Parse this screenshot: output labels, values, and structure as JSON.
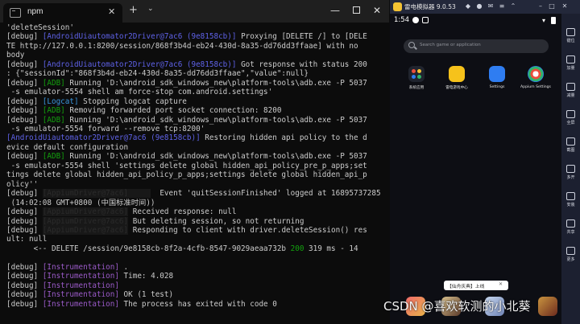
{
  "terminal": {
    "tab_title": "npm",
    "tab_close": "✕",
    "new_tab": "+",
    "dropdown": "⌄",
    "minimize": "—",
    "close": "✕",
    "lines": [
      {
        "segments": [
          {
            "t": "'deleteSession'",
            "c": ""
          }
        ]
      },
      {
        "segments": [
          {
            "t": "[debug] ",
            "c": ""
          },
          {
            "t": "[AndroidUiautomator2Driver@7ac6 (9e8158cb)]",
            "c": "blue"
          },
          {
            "t": " Proxying [DELETE /] to [DELE",
            "c": ""
          }
        ]
      },
      {
        "segments": [
          {
            "t": "TE http://127.0.0.1:8200/session/868f3b4d-eb24-430d-8a35-dd76dd3ffaae] with no",
            "c": ""
          }
        ]
      },
      {
        "segments": [
          {
            "t": "body",
            "c": ""
          }
        ]
      },
      {
        "segments": [
          {
            "t": "[debug] ",
            "c": ""
          },
          {
            "t": "[AndroidUiautomator2Driver@7ac6 (9e8158cb)]",
            "c": "blue"
          },
          {
            "t": " Got response with status 200",
            "c": ""
          }
        ]
      },
      {
        "segments": [
          {
            "t": ": {\"sessionId\":\"868f3b4d-eb24-430d-8a35-dd76dd3ffaae\",\"value\":null}",
            "c": ""
          }
        ]
      },
      {
        "segments": [
          {
            "t": "[debug] ",
            "c": ""
          },
          {
            "t": "[ADB]",
            "c": "green"
          },
          {
            "t": " Running 'D:\\android_sdk_windows_new\\platform-tools\\adb.exe -P 5037",
            "c": ""
          }
        ]
      },
      {
        "segments": [
          {
            "t": " -s emulator-5554 shell am force-stop com.android.settings'",
            "c": ""
          }
        ]
      },
      {
        "segments": [
          {
            "t": "[debug] ",
            "c": ""
          },
          {
            "t": "[Logcat]",
            "c": "lblue"
          },
          {
            "t": " Stopping logcat capture",
            "c": ""
          }
        ]
      },
      {
        "segments": [
          {
            "t": "[debug] ",
            "c": ""
          },
          {
            "t": "[ADB]",
            "c": "green"
          },
          {
            "t": " Removing forwarded port socket connection: 8200",
            "c": ""
          }
        ]
      },
      {
        "segments": [
          {
            "t": "[debug] ",
            "c": ""
          },
          {
            "t": "[ADB]",
            "c": "green"
          },
          {
            "t": " Running 'D:\\android_sdk_windows_new\\platform-tools\\adb.exe -P 5037",
            "c": ""
          }
        ]
      },
      {
        "segments": [
          {
            "t": " -s emulator-5554 forward --remove tcp:8200'",
            "c": ""
          }
        ]
      },
      {
        "segments": [
          {
            "t": "[AndroidUiautomator2Driver@7ac6 (9e8158cb)]",
            "c": "blue"
          },
          {
            "t": " Restoring hidden api policy to the d",
            "c": ""
          }
        ]
      },
      {
        "segments": [
          {
            "t": "evice default configuration",
            "c": ""
          }
        ]
      },
      {
        "segments": [
          {
            "t": "[debug] ",
            "c": ""
          },
          {
            "t": "[ADB]",
            "c": "green"
          },
          {
            "t": " Running 'D:\\android_sdk_windows_new\\platform-tools\\adb.exe -P 5037",
            "c": ""
          }
        ]
      },
      {
        "segments": [
          {
            "t": " -s emulator-5554 shell 'settings delete global hidden_api_policy_pre_p_apps;set",
            "c": ""
          }
        ]
      },
      {
        "segments": [
          {
            "t": "tings delete global hidden_api_policy_p_apps;settings delete global hidden_api_p",
            "c": ""
          }
        ]
      },
      {
        "segments": [
          {
            "t": "olicy''",
            "c": ""
          }
        ]
      },
      {
        "segments": [
          {
            "t": "[debug] ",
            "c": ""
          },
          {
            "t": "[AppiumDriver@7ac6]     ",
            "c": "blurred"
          },
          {
            "t": "  Event 'quitSessionFinished' logged at 1689573728543",
            "c": ""
          }
        ]
      },
      {
        "segments": [
          {
            "t": " (14:02:08 GMT+0800 (中国标准时间))",
            "c": ""
          }
        ]
      },
      {
        "segments": [
          {
            "t": "[debug] ",
            "c": ""
          },
          {
            "t": "[AppiumDriver@7ac6]",
            "c": "blurred"
          },
          {
            "t": " Received response: null",
            "c": ""
          }
        ]
      },
      {
        "segments": [
          {
            "t": "[debug] ",
            "c": ""
          },
          {
            "t": "[AppiumDriver@7ac6]",
            "c": "blurred"
          },
          {
            "t": " But deleting session, so not returning",
            "c": ""
          }
        ]
      },
      {
        "segments": [
          {
            "t": "[debug] ",
            "c": ""
          },
          {
            "t": "[AppiumDriver@7ac6]",
            "c": "blurred"
          },
          {
            "t": " Responding to client with driver.deleteSession() res",
            "c": ""
          }
        ]
      },
      {
        "segments": [
          {
            "t": "ult: null",
            "c": ""
          }
        ]
      },
      {
        "segments": [
          {
            "t": "      <-- DELETE /session/9e8158cb-8f2a-4cfb-8547-9029aeaa732b ",
            "c": ""
          },
          {
            "t": "200",
            "c": "green"
          },
          {
            "t": " 319 ms - 14",
            "c": ""
          }
        ]
      },
      {
        "segments": [
          {
            "t": " ",
            "c": ""
          }
        ]
      },
      {
        "segments": [
          {
            "t": "[debug] ",
            "c": ""
          },
          {
            "t": "[Instrumentation]",
            "c": "magenta"
          },
          {
            "t": " .",
            "c": ""
          }
        ]
      },
      {
        "segments": [
          {
            "t": "[debug] ",
            "c": ""
          },
          {
            "t": "[Instrumentation]",
            "c": "magenta"
          },
          {
            "t": " Time: 4.028",
            "c": ""
          }
        ]
      },
      {
        "segments": [
          {
            "t": "[debug] ",
            "c": ""
          },
          {
            "t": "[Instrumentation]",
            "c": "magenta"
          }
        ]
      },
      {
        "segments": [
          {
            "t": "[debug] ",
            "c": ""
          },
          {
            "t": "[Instrumentation]",
            "c": "magenta"
          },
          {
            "t": " OK (1 test)",
            "c": ""
          }
        ]
      },
      {
        "segments": [
          {
            "t": "[debug] ",
            "c": ""
          },
          {
            "t": "[Instrumentation]",
            "c": "magenta"
          },
          {
            "t": " The process has exited with code 0",
            "c": ""
          }
        ]
      }
    ]
  },
  "emulator": {
    "title": "雷电模拟器 9.0.53",
    "clock": "1:54",
    "search_placeholder": "Search game or application",
    "apps": [
      {
        "label": "系统应用",
        "icon": "system-apps-icon"
      },
      {
        "label": "雷电游戏中心",
        "icon": "game-center-icon"
      },
      {
        "label": "Settings",
        "icon": "settings-icon"
      },
      {
        "label": "Appium Settings",
        "icon": "appium-settings-icon"
      }
    ],
    "promo": "【仙舟庆典】上线",
    "promo_close": "✕",
    "toolbar": [
      "键位",
      "加量",
      "减量",
      "全屏",
      "截图",
      "多开",
      "安装",
      "共享",
      "更多"
    ]
  },
  "watermark": "CSDN @喜欢软测的小北葵"
}
